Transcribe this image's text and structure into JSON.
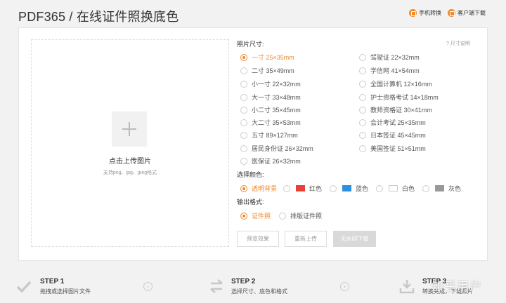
{
  "header": {
    "title": "PDF365 / 在线证件照换底色",
    "mobile_label": "手机转换",
    "client_label": "客户端下载"
  },
  "upload": {
    "title": "点击上传图片",
    "hint": "支持png、jpg、jpeg格式"
  },
  "size": {
    "section_label": "照片尺寸:",
    "spec_link": "尺寸说明",
    "left": [
      {
        "label": "一寸 25×35mm",
        "selected": true
      },
      {
        "label": "二寸 35×49mm",
        "selected": false
      },
      {
        "label": "小一寸 22×32mm",
        "selected": false
      },
      {
        "label": "大一寸 33×48mm",
        "selected": false
      },
      {
        "label": "小二寸 35×45mm",
        "selected": false
      },
      {
        "label": "大二寸 35×53mm",
        "selected": false
      },
      {
        "label": "五寸 89×127mm",
        "selected": false
      },
      {
        "label": "居民身份证 26×32mm",
        "selected": false
      },
      {
        "label": "医保证 26×32mm",
        "selected": false
      }
    ],
    "right": [
      {
        "label": "驾驶证 22×32mm",
        "selected": false
      },
      {
        "label": "学信网 41×54mm",
        "selected": false
      },
      {
        "label": "全国计算机 12×16mm",
        "selected": false
      },
      {
        "label": "护士资格考试 14×18mm",
        "selected": false
      },
      {
        "label": "教师资格证 30×41mm",
        "selected": false
      },
      {
        "label": "会计考试 25×35mm",
        "selected": false
      },
      {
        "label": "日本签证 45×45mm",
        "selected": false
      },
      {
        "label": "美国签证 51×51mm",
        "selected": false
      }
    ]
  },
  "color": {
    "section_label": "选择颜色:",
    "options": [
      {
        "label": "透明背景",
        "selected": true,
        "swatch": null
      },
      {
        "label": "红色",
        "selected": false,
        "swatch": "#e8413a"
      },
      {
        "label": "蓝色",
        "selected": false,
        "swatch": "#2f8fe0"
      },
      {
        "label": "白色",
        "selected": false,
        "swatch": "#ffffff"
      },
      {
        "label": "灰色",
        "selected": false,
        "swatch": "#999999"
      }
    ]
  },
  "format": {
    "section_label": "输出格式:",
    "options": [
      {
        "label": "证件照",
        "selected": true
      },
      {
        "label": "排版证件照",
        "selected": false
      }
    ]
  },
  "buttons": {
    "preview": "预览效果",
    "reupload": "重新上传",
    "download": "无水印下载"
  },
  "steps": [
    {
      "title": "STEP 1",
      "desc": "拖拽或选择图片文件"
    },
    {
      "title": "STEP 2",
      "desc": "选择尺寸、底色和格式"
    },
    {
      "title": "STEP 3",
      "desc": "转换完成，下载照片"
    }
  ],
  "watermark": "知乎用户",
  "accent": "#f08a2e"
}
